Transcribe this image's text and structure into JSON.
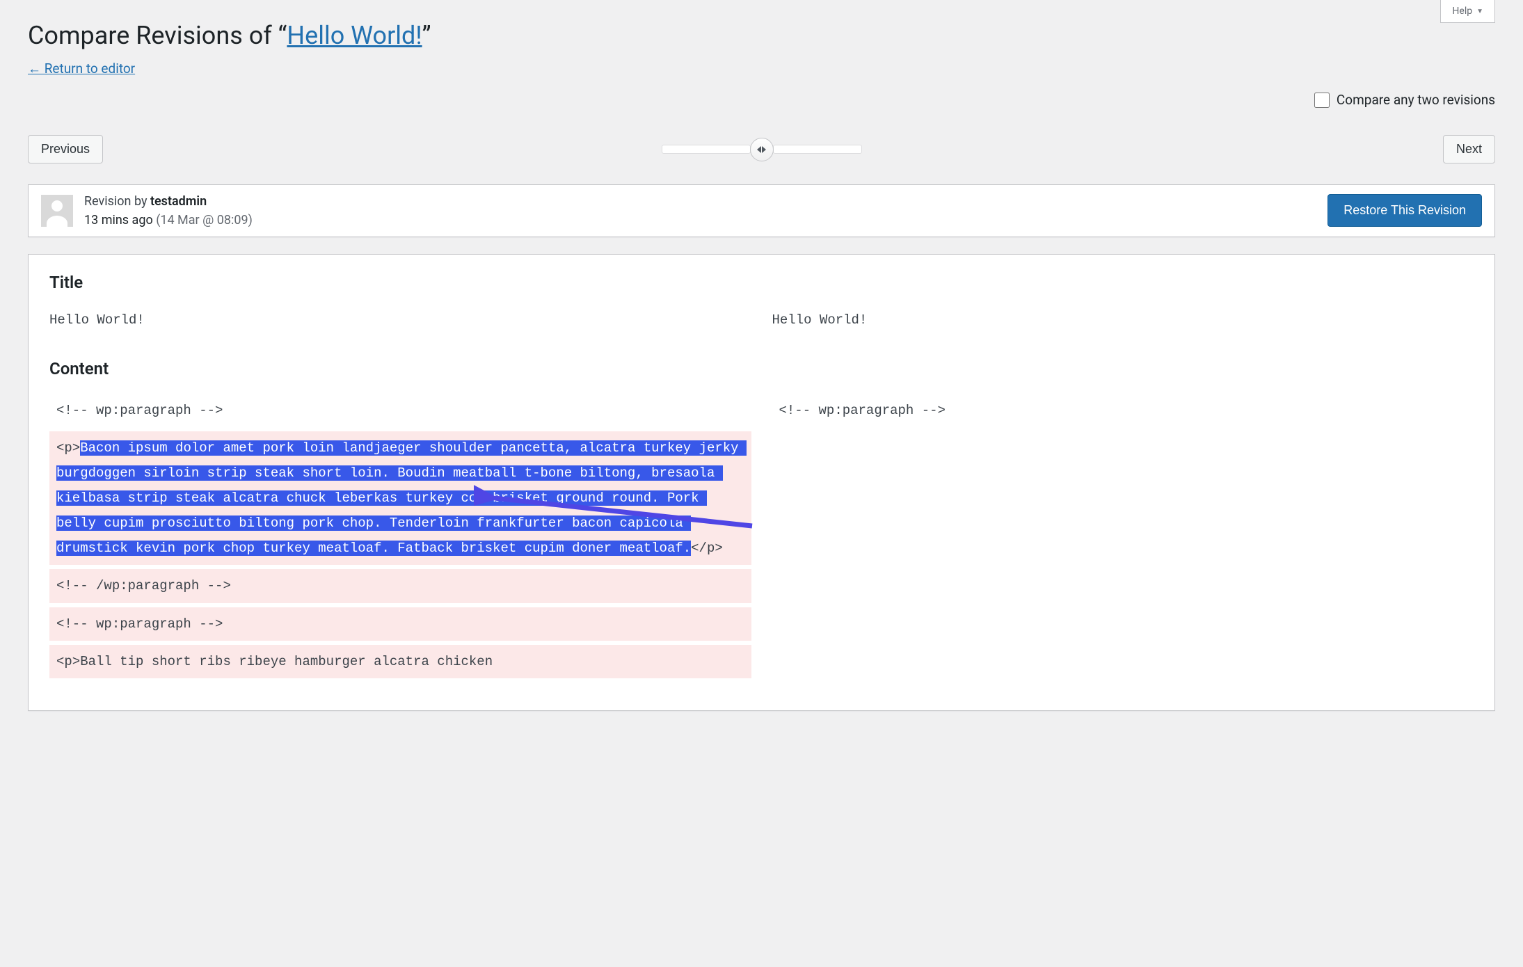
{
  "help": {
    "label": "Help"
  },
  "header": {
    "prefix": "Compare Revisions of “",
    "post_title": "Hello World!",
    "suffix": "”",
    "return_link": "← Return to editor"
  },
  "compare_toggle_label": "Compare any two revisions",
  "nav": {
    "previous": "Previous",
    "next": "Next"
  },
  "meta": {
    "revision_by_prefix": "Revision by ",
    "author": "testadmin",
    "time_ago": "13 mins ago",
    "datetime": "(14 Mar @ 08:09)",
    "restore_label": "Restore This Revision"
  },
  "diff": {
    "title_heading": "Title",
    "title_left": "Hello World!",
    "title_right": "Hello World!",
    "content_heading": "Content",
    "rows": [
      {
        "left": "<!-- wp:paragraph -->",
        "right": "<!-- wp:paragraph -->",
        "left_class": "plain",
        "right_class": "plain"
      },
      {
        "left_prefix": "<p>",
        "left_sel": "Bacon ipsum dolor amet pork loin landjaeger shoulder pancetta, alcatra turkey jerky burgdoggen sirloin strip steak short loin. Boudin meatball t-bone biltong, bresaola kielbasa strip steak alcatra chuck leberkas turkey cow brisket ground round. Pork belly cupim prosciutto biltong pork chop. Tenderloin frankfurter bacon capicola drumstick kevin pork chop turkey meatloaf. Fatback brisket cupim doner meatloaf.",
        "left_suffix": "</p>",
        "right": "",
        "left_class": "removed",
        "right_class": "plain"
      },
      {
        "left": "<!-- /wp:paragraph -->",
        "right": "",
        "left_class": "removed",
        "right_class": "plain"
      },
      {
        "left": "<!-- wp:paragraph -->",
        "right": "",
        "left_class": "removed",
        "right_class": "plain"
      },
      {
        "left": "<p>Ball tip short ribs ribeye hamburger alcatra chicken",
        "right": "",
        "left_class": "removed",
        "right_class": "plain"
      }
    ]
  }
}
